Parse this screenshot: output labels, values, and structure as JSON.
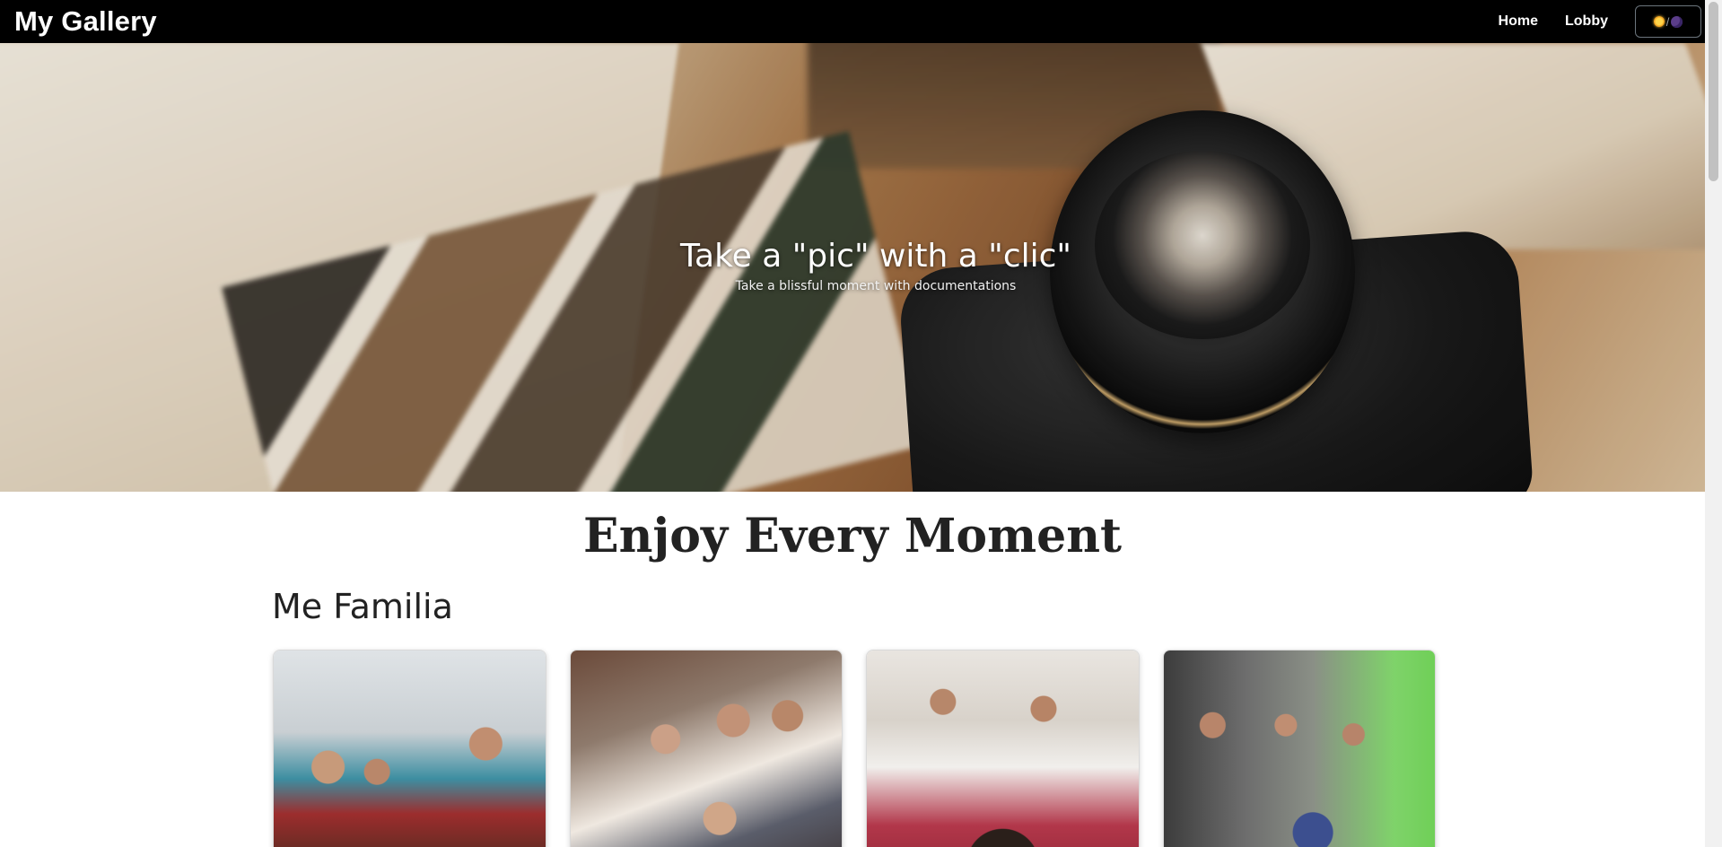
{
  "navbar": {
    "brand": "My Gallery",
    "links": [
      {
        "label": "Home"
      },
      {
        "label": "Lobby"
      }
    ],
    "theme_toggle": {
      "separator": "/",
      "icons": [
        "sun-icon",
        "moon-icon"
      ]
    }
  },
  "hero": {
    "title": "Take a \"pic\" with a \"clic\"",
    "subtitle": "Take a blissful moment with documentations",
    "image": "camera-and-photos"
  },
  "main": {
    "heading": "Enjoy Every Moment",
    "sections": [
      {
        "title": "Me Familia",
        "photos": [
          "family-dinner-photo",
          "family-group-photo",
          "family-selfie-photo",
          "family-gathering-photo"
        ]
      }
    ]
  },
  "colors": {
    "navbar_bg": "#000000",
    "page_bg": "#ffffff",
    "heading_text": "#222222"
  }
}
